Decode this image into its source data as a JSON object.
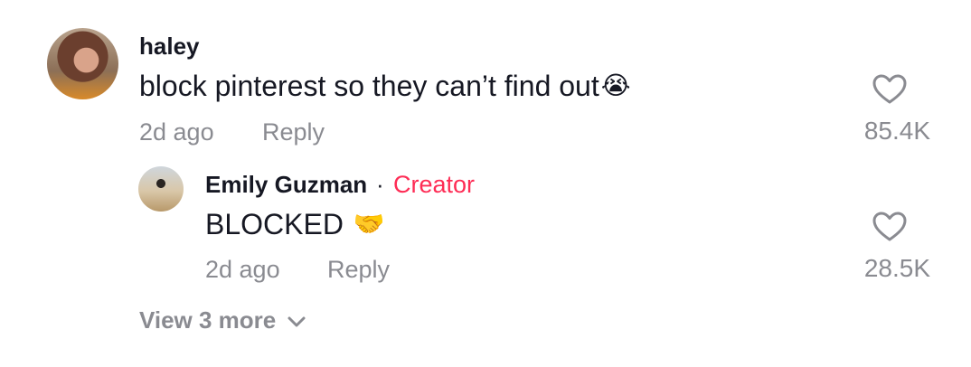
{
  "comments": [
    {
      "username": "haley",
      "text": "block pinterest so they can’t find out",
      "emoji": "😭",
      "emoji_icon": "loudly-crying-face-emoji",
      "time": "2d ago",
      "reply_label": "Reply",
      "likes": "85.4K"
    }
  ],
  "reply": {
    "username": "Emily Guzman",
    "separator": "·",
    "badge": "Creator",
    "badge_color": "#fe2c55",
    "text": "BLOCKED",
    "emoji": "🤝",
    "emoji_icon": "handshake-emoji",
    "time": "2d ago",
    "reply_label": "Reply",
    "likes": "28.5K"
  },
  "view_more": {
    "label": "View 3 more",
    "icon": "chevron-down-icon"
  },
  "colors": {
    "text_primary": "#161823",
    "text_secondary": "#8a8b91",
    "accent": "#fe2c55"
  }
}
